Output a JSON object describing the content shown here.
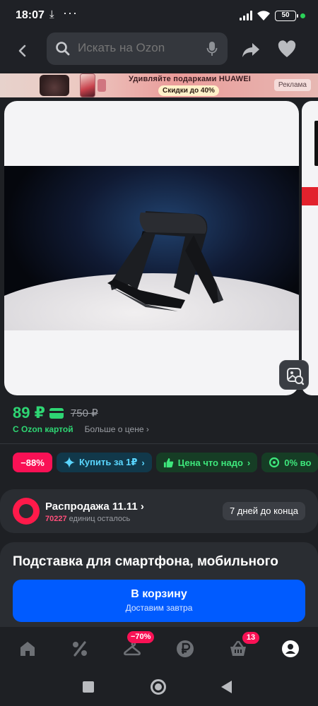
{
  "status_bar": {
    "time": "18:07",
    "download_glyph": "⤓",
    "dots": "···",
    "battery": "50"
  },
  "search": {
    "placeholder": "Искать на Ozon"
  },
  "ad": {
    "title": "Удивляйте подарками HUAWEI",
    "discount": "Скидки до 40%",
    "tag": "Реклама"
  },
  "price": {
    "current": "89 ₽",
    "old": "750 ₽",
    "card_label": "С Ozon картой",
    "more_label": "Больше о цене ›"
  },
  "chips": {
    "discount": "−88%",
    "buy": "Купить за 1₽",
    "good": "Цена что надо",
    "zero": "0% во"
  },
  "sale": {
    "title": "Распродажа 11.11 ›",
    "left_count": "70227",
    "left_text": " единиц осталось",
    "deadline": "7 дней до конца"
  },
  "product": {
    "title": "Подставка для смартфона, мобильного"
  },
  "cart": {
    "label": "В корзину",
    "sub": "Доставим завтра"
  },
  "bottom_nav": {
    "discount_badge": "−70%",
    "cart_badge": "13"
  },
  "icons": [
    "back-icon",
    "search-icon",
    "mic-icon",
    "share-icon",
    "heart-icon",
    "similar-search-icon",
    "home-icon",
    "percent-icon",
    "hanger-icon",
    "ruble-icon",
    "basket-icon",
    "profile-icon"
  ],
  "colors": {
    "accent_green": "#2ed573",
    "cart_blue": "#005bff",
    "badge_pink": "#f91155",
    "background": "#1e2024"
  }
}
